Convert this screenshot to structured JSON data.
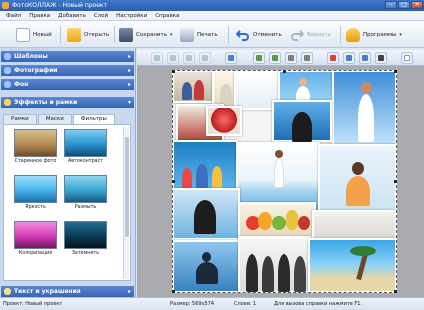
{
  "window": {
    "title": "ФотоКОЛЛАЖ - Новый проект"
  },
  "menu": [
    "Файл",
    "Правка",
    "Добавить",
    "Слой",
    "Настройки",
    "Справка"
  ],
  "toolbar": {
    "new_label": "Новый",
    "open_label": "Открыть",
    "save_label": "Сохранить",
    "print_label": "Печать",
    "undo_label": "Отменить",
    "redo_label": "Вернуть",
    "programs_label": "Программы"
  },
  "sidebar": {
    "categories": [
      "Шаблоны",
      "Фотографии",
      "Фон",
      "Эффекты и рамки"
    ],
    "subtabs": [
      "Рамки",
      "Маски",
      "Фильтры"
    ],
    "active_subtab": "Фильтры",
    "filters": [
      {
        "label": "Старинное фото",
        "colors": [
          "#c9a36a",
          "#8a6a3c"
        ]
      },
      {
        "label": "Автоконтраст",
        "colors": [
          "#2f9ad3",
          "#0e5b8c"
        ]
      },
      {
        "label": "Яркость",
        "colors": [
          "#58c3f0",
          "#1f78b6"
        ]
      },
      {
        "label": "Размыть",
        "colors": [
          "#3fb0d8",
          "#175f86"
        ]
      },
      {
        "label": "Колоризация",
        "colors": [
          "#e24ac8",
          "#7d1a6c"
        ]
      },
      {
        "label": "Затемнить",
        "colors": [
          "#12506f",
          "#051a26"
        ]
      }
    ],
    "text_section": "Текст и украшения"
  },
  "statusbar": {
    "project": "Проект: Новый проект",
    "size": "Размер: 569x574",
    "layers": "Слоев: 1",
    "help": "Для вызова справки нажмите F1."
  },
  "colors": {
    "accent": "#3465b6",
    "titlebar": "#2b5fae",
    "work_surface": "#a9abae"
  }
}
